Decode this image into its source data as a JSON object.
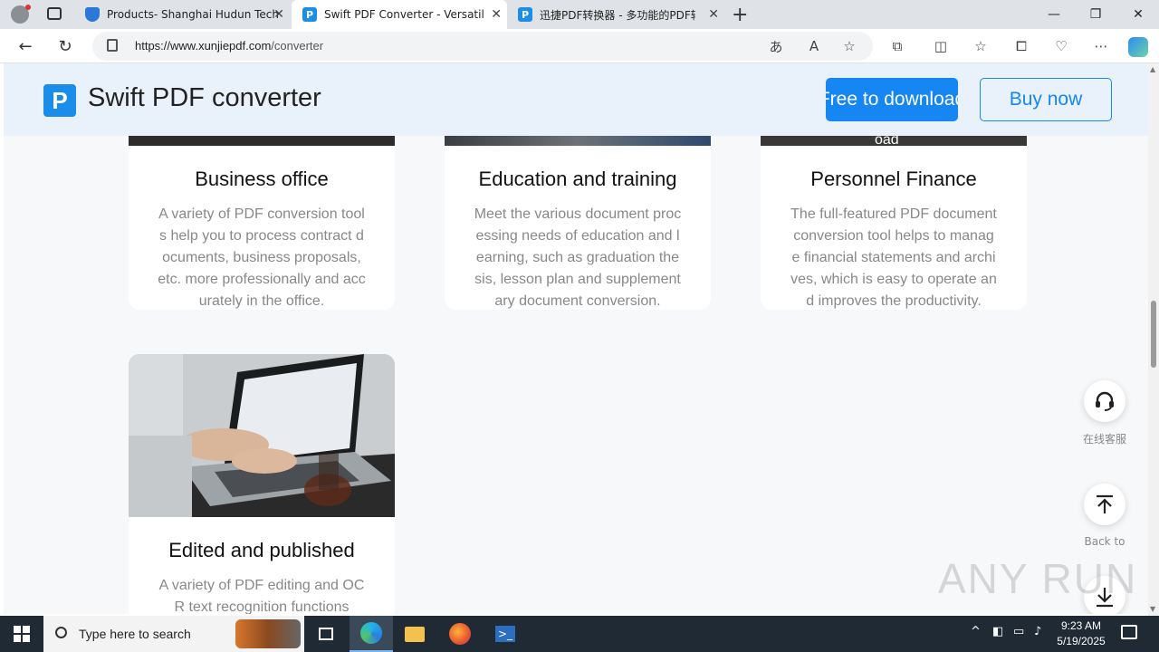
{
  "browser": {
    "tabs": [
      {
        "title": "Products- Shanghai Hudun Tech",
        "icon": "shield-icon"
      },
      {
        "title": "Swift PDF Converter - Versatile PD",
        "icon": "pdf-logo-icon"
      },
      {
        "title": "迅捷PDF转换器 - 多功能的PDF转",
        "icon": "pdf-logo-icon"
      }
    ],
    "active_tab": 1,
    "url_host": "https://www.xunjiepdf.com",
    "url_path": "/converter"
  },
  "site": {
    "brand": "Swift PDF converter",
    "free_download": "Free to download",
    "buy_now": "Buy now"
  },
  "cards": [
    {
      "title": "Business office",
      "desc": "A variety of PDF conversion tools help you to process contract documents, business proposals, etc. more professionally and accurately in the office."
    },
    {
      "title": "Education and training",
      "desc": "Meet the various document processing needs of education and learning, such as graduation thesis, lesson plan and supplementary document conversion."
    },
    {
      "title": "Personnel Finance",
      "desc": "The full-featured PDF document conversion tool helps to manage financial statements and archives, which is easy to operate and improves the productivity."
    },
    {
      "title": "Edited and published",
      "desc": "A variety of PDF editing and OCR text recognition functions"
    }
  ],
  "card3_overlay": "oad",
  "float": {
    "service_label": "在线客服",
    "back_label": "Back to"
  },
  "taskbar": {
    "search_placeholder": "Type here to search",
    "time": "9:23 AM",
    "date": "5/19/2025"
  },
  "watermark": "ANY RUN"
}
